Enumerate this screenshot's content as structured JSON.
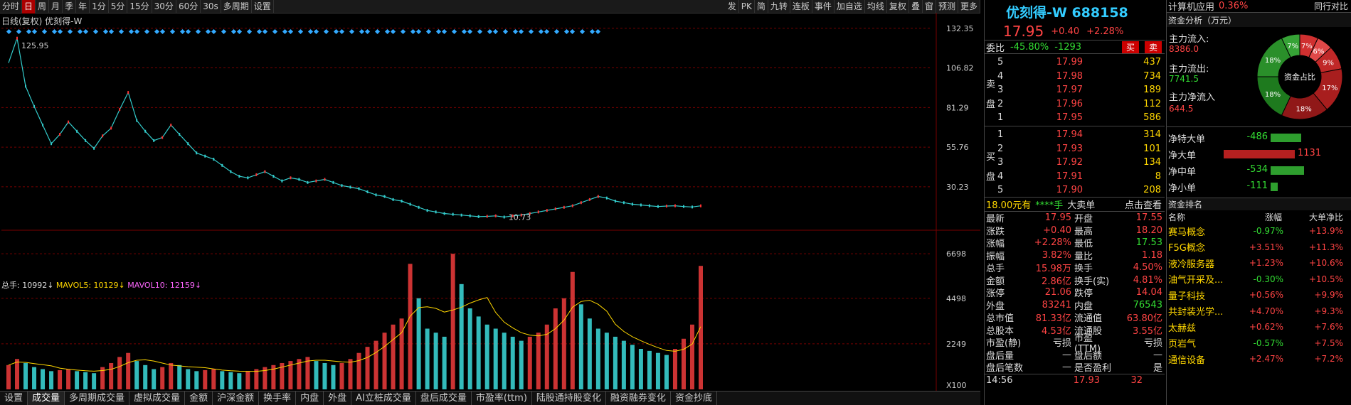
{
  "toolbar": {
    "left": [
      "分时",
      "日",
      "周",
      "月",
      "季",
      "年",
      "1分",
      "5分",
      "15分",
      "30分",
      "60分",
      "30s",
      "多周期",
      "设置"
    ],
    "active": "日",
    "right": [
      "发",
      "PK",
      "简",
      "九转",
      "连板",
      "事件",
      "加自选",
      "均线",
      "复权",
      "叠",
      "窗",
      "预测",
      "更多"
    ]
  },
  "chart": {
    "title": "日线(复权) 优刻得-W",
    "y_ticks": [
      "132.35",
      "106.82",
      "81.29",
      "55.76",
      "30.23"
    ],
    "high_label": "125.95",
    "low_label": "10.73",
    "vol_ticks": [
      "6698",
      "4498",
      "2249",
      "X100"
    ],
    "vol_header": {
      "total": "总手: 10992↓",
      "mavol5": "MAVOL5: 10129↓",
      "mavol10": "MAVOL10: 12159↓"
    }
  },
  "chart_data": {
    "type": "line",
    "title": "日线(复权) 优刻得-W",
    "y_ticks": [
      132.35,
      106.82,
      81.29,
      55.76,
      30.23
    ],
    "ylim": [
      5,
      135
    ],
    "high": 125.95,
    "low": 10.73,
    "close_series": [
      110,
      125.95,
      95,
      82,
      70,
      58,
      64,
      72,
      66,
      60,
      55,
      63,
      68,
      80,
      91,
      73,
      66,
      60,
      62,
      70,
      64,
      58,
      52,
      50,
      48,
      44,
      40,
      37,
      36,
      38,
      40,
      37,
      34,
      36,
      35,
      33,
      34,
      35,
      33,
      31,
      30,
      29,
      27,
      25,
      24,
      22,
      21,
      19,
      17,
      15,
      14,
      13,
      12.5,
      12,
      11.5,
      11,
      11.2,
      11.5,
      10.73,
      11.5,
      12,
      13,
      14,
      15,
      16,
      17,
      18,
      20,
      22,
      24,
      23,
      21,
      20,
      19,
      18.5,
      18,
      17.5,
      17.8,
      18,
      17.5,
      17.2,
      17.95
    ],
    "volume_series": [
      1200,
      1500,
      1300,
      1100,
      1000,
      900,
      950,
      1000,
      900,
      850,
      800,
      1100,
      1300,
      1600,
      1800,
      1400,
      1200,
      1000,
      1100,
      1300,
      1200,
      1000,
      900,
      950,
      1000,
      900,
      850,
      800,
      900,
      1000,
      1100,
      1200,
      1300,
      1400,
      1500,
      1600,
      1400,
      1300,
      1200,
      1300,
      1500,
      1800,
      2100,
      2400,
      2800,
      3200,
      3500,
      6200,
      4500,
      3000,
      2800,
      2600,
      6698,
      5200,
      4000,
      3600,
      3200,
      3000,
      2800,
      2600,
      2400,
      2600,
      2800,
      3200,
      4000,
      4500,
      5800,
      4200,
      3500,
      3000,
      2800,
      2600,
      2400,
      2200,
      2000,
      1900,
      1800,
      1700,
      2000,
      2500,
      3200,
      6100
    ],
    "vol_ticks": [
      6698,
      4498,
      2249
    ],
    "vol_unit": "X100"
  },
  "bottom_tabs": [
    "设置",
    "成交量",
    "多周期成交量",
    "虚拟成交量",
    "金额",
    "沪深金额",
    "换手率",
    "内盘",
    "外盘",
    "AI立桩成交量",
    "盘后成交量",
    "市盈率(ttm)",
    "陆股通持股变化",
    "融资融券变化",
    "资金抄底"
  ],
  "quote": {
    "name": "优刻得-W 688158",
    "price": "17.95",
    "change": "+0.40",
    "change_pct": "+2.28%",
    "weibi_label": "委比",
    "weibi": "-45.80%",
    "weicha": "-1293",
    "buy_btn": "买",
    "sell_btn": "卖",
    "sell_label": "卖盘",
    "buy_label": "买盘",
    "asks": [
      {
        "n": "5",
        "p": "17.99",
        "v": "437"
      },
      {
        "n": "4",
        "p": "17.98",
        "v": "734"
      },
      {
        "n": "3",
        "p": "17.97",
        "v": "189"
      },
      {
        "n": "2",
        "p": "17.96",
        "v": "112"
      },
      {
        "n": "1",
        "p": "17.95",
        "v": "586"
      }
    ],
    "bids": [
      {
        "n": "1",
        "p": "17.94",
        "v": "314"
      },
      {
        "n": "2",
        "p": "17.93",
        "v": "101"
      },
      {
        "n": "3",
        "p": "17.92",
        "v": "134"
      },
      {
        "n": "4",
        "p": "17.91",
        "v": "8"
      },
      {
        "n": "5",
        "p": "17.90",
        "v": "208"
      }
    ],
    "big_order": {
      "price": "18.00元有",
      "qty": "****手",
      "label": "大卖单",
      "link": "点击查看"
    },
    "stats": [
      [
        "最新",
        "17.95",
        "开盘",
        "17.55"
      ],
      [
        "涨跌",
        "+0.40",
        "最高",
        "18.20"
      ],
      [
        "涨幅",
        "+2.28%",
        "最低",
        "17.53"
      ],
      [
        "振幅",
        "3.82%",
        "量比",
        "1.18"
      ],
      [
        "总手",
        "15.98万",
        "换手",
        "4.50%"
      ],
      [
        "金额",
        "2.86亿",
        "换手(实)",
        "4.81%"
      ],
      [
        "涨停",
        "21.06",
        "跌停",
        "14.04"
      ],
      [
        "外盘",
        "83241",
        "内盘",
        "76543"
      ],
      [
        "总市值",
        "81.33亿",
        "流通值",
        "63.80亿"
      ],
      [
        "总股本",
        "4.53亿",
        "流通股",
        "3.55亿"
      ],
      [
        "市盈(静)",
        "亏损",
        "市盈(TTM)",
        "亏损"
      ],
      [
        "盘后量",
        "—",
        "盘后额",
        "—"
      ],
      [
        "盘后笔数",
        "—",
        "是否盈利",
        "是"
      ]
    ],
    "tick": {
      "time": "14:56",
      "price": "17.93",
      "vol": "32"
    }
  },
  "fund": {
    "sector": "计算机应用",
    "sector_pct": "0.36%",
    "compare": "同行对比",
    "section": "资金分析（万元）",
    "inflow_label": "主力流入:",
    "inflow": "8386.0",
    "outflow_label": "主力流出:",
    "outflow": "7741.5",
    "net_label": "主力净流入",
    "net": "644.5",
    "donut_center": "资金占比",
    "donut_pcts": [
      "7%",
      "6%",
      "9%",
      "17%",
      "18%",
      "18%",
      "18%",
      "7%"
    ],
    "orders": [
      {
        "label": "净特大单",
        "val": "-486"
      },
      {
        "label": "净大单",
        "val": "1131"
      },
      {
        "label": "净中单",
        "val": "-534"
      },
      {
        "label": "净小单",
        "val": "-111"
      }
    ],
    "rank_title": "资金排名",
    "rank_link": "排名",
    "rank_headers": [
      "名称",
      "涨幅",
      "大单净比"
    ],
    "rank_rows": [
      {
        "name": "赛马概念",
        "chg": "-0.97%",
        "net": "+13.9%"
      },
      {
        "name": "F5G概念",
        "chg": "+3.51%",
        "net": "+11.3%"
      },
      {
        "name": "液冷服务器",
        "chg": "+1.23%",
        "net": "+10.6%"
      },
      {
        "name": "油气开采及...",
        "chg": "-0.30%",
        "net": "+10.5%"
      },
      {
        "name": "量子科技",
        "chg": "+0.56%",
        "net": "+9.9%"
      },
      {
        "name": "共封装光学...",
        "chg": "+4.70%",
        "net": "+9.3%"
      },
      {
        "name": "太赫兹",
        "chg": "+0.62%",
        "net": "+7.6%"
      },
      {
        "name": "页岩气",
        "chg": "-0.57%",
        "net": "+7.5%"
      },
      {
        "name": "通信设备",
        "chg": "+2.47%",
        "net": "+7.2%"
      }
    ]
  }
}
